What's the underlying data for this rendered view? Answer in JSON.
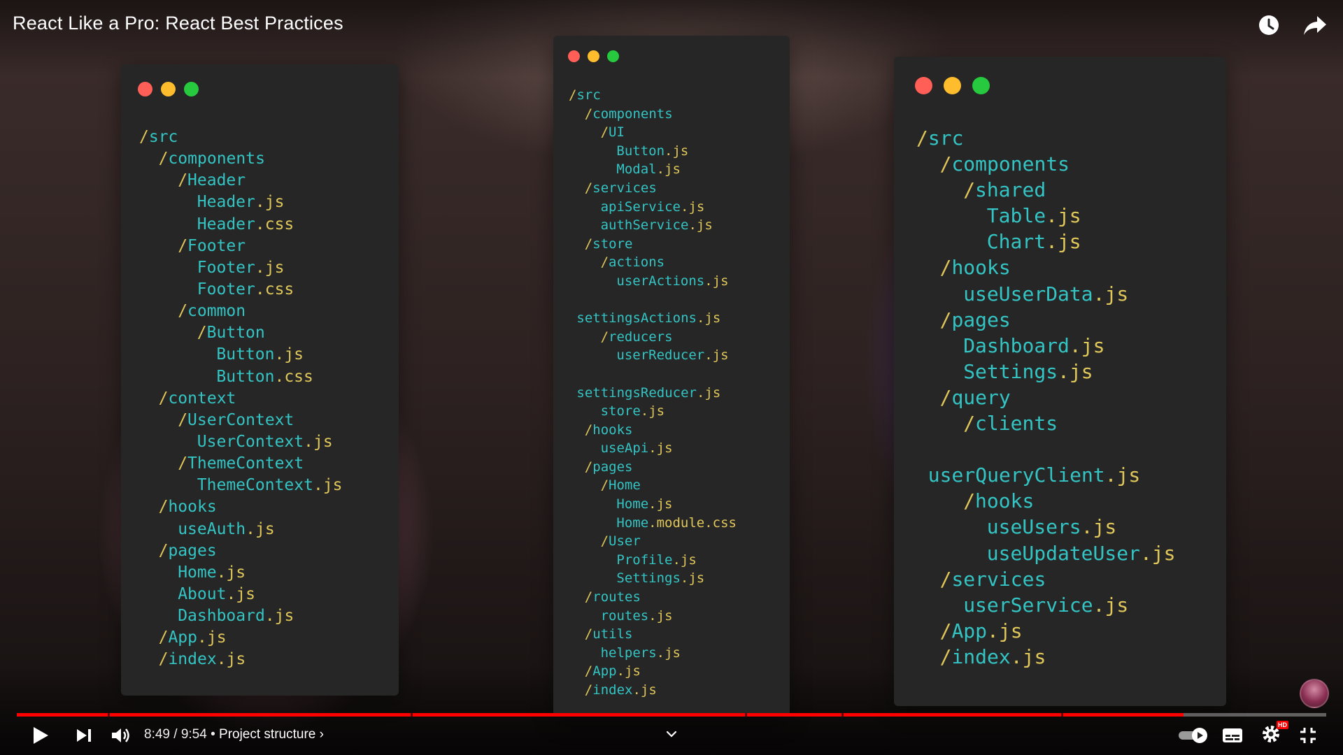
{
  "video": {
    "title": "React Like a Pro: React Best Practices",
    "current_time": "8:49",
    "duration": "9:54",
    "time_display": "8:49 / 9:54",
    "separator": " • ",
    "chapter": "Project structure",
    "chapter_chevron": "›",
    "progress": 0.891,
    "hd_badge": "HD"
  },
  "icons": {
    "watch_later": "clock-icon",
    "share": "share-arrow-icon",
    "play": "play-icon",
    "next": "skip-next-icon",
    "volume": "volume-icon",
    "expand": "chevron-down-icon",
    "autoplay": "autoplay-toggle-icon",
    "subtitles": "subtitles-icon",
    "settings": "gear-icon",
    "fullscreen_exit": "fullscreen-exit-icon"
  },
  "colors": {
    "progress_red": "#ff0000",
    "name_cyan": "#34c4c4",
    "punct_yellow": "#e0c75a",
    "panel_bg": "#262626"
  },
  "panels": [
    {
      "id": "left",
      "lines": [
        {
          "indent": 0,
          "prefix": "/",
          "name": "src",
          "ext": ""
        },
        {
          "indent": 1,
          "prefix": "/",
          "name": "components",
          "ext": ""
        },
        {
          "indent": 2,
          "prefix": "/",
          "name": "Header",
          "ext": ""
        },
        {
          "indent": 3,
          "prefix": "",
          "name": "Header",
          "ext": ".js"
        },
        {
          "indent": 3,
          "prefix": "",
          "name": "Header",
          "ext": ".css"
        },
        {
          "indent": 2,
          "prefix": "/",
          "name": "Footer",
          "ext": ""
        },
        {
          "indent": 3,
          "prefix": "",
          "name": "Footer",
          "ext": ".js"
        },
        {
          "indent": 3,
          "prefix": "",
          "name": "Footer",
          "ext": ".css"
        },
        {
          "indent": 2,
          "prefix": "/",
          "name": "common",
          "ext": ""
        },
        {
          "indent": 3,
          "prefix": "/",
          "name": "Button",
          "ext": ""
        },
        {
          "indent": 4,
          "prefix": "",
          "name": "Button",
          "ext": ".js"
        },
        {
          "indent": 4,
          "prefix": "",
          "name": "Button",
          "ext": ".css"
        },
        {
          "indent": 1,
          "prefix": "/",
          "name": "context",
          "ext": ""
        },
        {
          "indent": 2,
          "prefix": "/",
          "name": "UserContext",
          "ext": ""
        },
        {
          "indent": 3,
          "prefix": "",
          "name": "UserContext",
          "ext": ".js"
        },
        {
          "indent": 2,
          "prefix": "/",
          "name": "ThemeContext",
          "ext": ""
        },
        {
          "indent": 3,
          "prefix": "",
          "name": "ThemeContext",
          "ext": ".js"
        },
        {
          "indent": 1,
          "prefix": "/",
          "name": "hooks",
          "ext": ""
        },
        {
          "indent": 2,
          "prefix": "",
          "name": "useAuth",
          "ext": ".js"
        },
        {
          "indent": 1,
          "prefix": "/",
          "name": "pages",
          "ext": ""
        },
        {
          "indent": 2,
          "prefix": "",
          "name": "Home",
          "ext": ".js"
        },
        {
          "indent": 2,
          "prefix": "",
          "name": "About",
          "ext": ".js"
        },
        {
          "indent": 2,
          "prefix": "",
          "name": "Dashboard",
          "ext": ".js"
        },
        {
          "indent": 1,
          "prefix": "/",
          "name": "App",
          "ext": ".js"
        },
        {
          "indent": 1,
          "prefix": "/",
          "name": "index",
          "ext": ".js"
        }
      ]
    },
    {
      "id": "mid",
      "lines": [
        {
          "indent": 0,
          "prefix": "/",
          "name": "src",
          "ext": ""
        },
        {
          "indent": 1,
          "prefix": "/",
          "name": "components",
          "ext": ""
        },
        {
          "indent": 2,
          "prefix": "/",
          "name": "UI",
          "ext": ""
        },
        {
          "indent": 3,
          "prefix": "",
          "name": "Button",
          "ext": ".js"
        },
        {
          "indent": 3,
          "prefix": "",
          "name": "Modal",
          "ext": ".js"
        },
        {
          "indent": 1,
          "prefix": "/",
          "name": "services",
          "ext": ""
        },
        {
          "indent": 2,
          "prefix": "",
          "name": "apiService",
          "ext": ".js"
        },
        {
          "indent": 2,
          "prefix": "",
          "name": "authService",
          "ext": ".js"
        },
        {
          "indent": 1,
          "prefix": "/",
          "name": "store",
          "ext": ""
        },
        {
          "indent": 2,
          "prefix": "/",
          "name": "actions",
          "ext": ""
        },
        {
          "indent": 3,
          "prefix": "",
          "name": "userActions",
          "ext": ".js"
        },
        {
          "indent": 0,
          "prefix": "",
          "name": "",
          "ext": ""
        },
        {
          "indent": 0.5,
          "prefix": "",
          "name": "settingsActions",
          "ext": ".js"
        },
        {
          "indent": 2,
          "prefix": "/",
          "name": "reducers",
          "ext": ""
        },
        {
          "indent": 3,
          "prefix": "",
          "name": "userReducer",
          "ext": ".js"
        },
        {
          "indent": 0,
          "prefix": "",
          "name": "",
          "ext": ""
        },
        {
          "indent": 0.5,
          "prefix": "",
          "name": "settingsReducer",
          "ext": ".js"
        },
        {
          "indent": 2,
          "prefix": "",
          "name": "store",
          "ext": ".js"
        },
        {
          "indent": 1,
          "prefix": "/",
          "name": "hooks",
          "ext": ""
        },
        {
          "indent": 2,
          "prefix": "",
          "name": "useApi",
          "ext": ".js"
        },
        {
          "indent": 1,
          "prefix": "/",
          "name": "pages",
          "ext": ""
        },
        {
          "indent": 2,
          "prefix": "/",
          "name": "Home",
          "ext": ""
        },
        {
          "indent": 3,
          "prefix": "",
          "name": "Home",
          "ext": ".js"
        },
        {
          "indent": 3,
          "prefix": "",
          "name": "Home",
          "ext": ".module.css"
        },
        {
          "indent": 2,
          "prefix": "/",
          "name": "User",
          "ext": ""
        },
        {
          "indent": 3,
          "prefix": "",
          "name": "Profile",
          "ext": ".js"
        },
        {
          "indent": 3,
          "prefix": "",
          "name": "Settings",
          "ext": ".js"
        },
        {
          "indent": 1,
          "prefix": "/",
          "name": "routes",
          "ext": ""
        },
        {
          "indent": 2,
          "prefix": "",
          "name": "routes",
          "ext": ".js"
        },
        {
          "indent": 1,
          "prefix": "/",
          "name": "utils",
          "ext": ""
        },
        {
          "indent": 2,
          "prefix": "",
          "name": "helpers",
          "ext": ".js"
        },
        {
          "indent": 1,
          "prefix": "/",
          "name": "App",
          "ext": ".js"
        },
        {
          "indent": 1,
          "prefix": "/",
          "name": "index",
          "ext": ".js"
        }
      ]
    },
    {
      "id": "right",
      "lines": [
        {
          "indent": 0,
          "prefix": "/",
          "name": "src",
          "ext": ""
        },
        {
          "indent": 1,
          "prefix": "/",
          "name": "components",
          "ext": ""
        },
        {
          "indent": 2,
          "prefix": "/",
          "name": "shared",
          "ext": ""
        },
        {
          "indent": 3,
          "prefix": "",
          "name": "Table",
          "ext": ".js"
        },
        {
          "indent": 3,
          "prefix": "",
          "name": "Chart",
          "ext": ".js"
        },
        {
          "indent": 1,
          "prefix": "/",
          "name": "hooks",
          "ext": ""
        },
        {
          "indent": 2,
          "prefix": "",
          "name": "useUserData",
          "ext": ".js"
        },
        {
          "indent": 1,
          "prefix": "/",
          "name": "pages",
          "ext": ""
        },
        {
          "indent": 2,
          "prefix": "",
          "name": "Dashboard",
          "ext": ".js"
        },
        {
          "indent": 2,
          "prefix": "",
          "name": "Settings",
          "ext": ".js"
        },
        {
          "indent": 1,
          "prefix": "/",
          "name": "query",
          "ext": ""
        },
        {
          "indent": 2,
          "prefix": "/",
          "name": "clients",
          "ext": ""
        },
        {
          "indent": 0,
          "prefix": "",
          "name": "",
          "ext": ""
        },
        {
          "indent": 0.5,
          "prefix": "",
          "name": "userQueryClient",
          "ext": ".js"
        },
        {
          "indent": 2,
          "prefix": "/",
          "name": "hooks",
          "ext": ""
        },
        {
          "indent": 3,
          "prefix": "",
          "name": "useUsers",
          "ext": ".js"
        },
        {
          "indent": 3,
          "prefix": "",
          "name": "useUpdateUser",
          "ext": ".js"
        },
        {
          "indent": 1,
          "prefix": "/",
          "name": "services",
          "ext": ""
        },
        {
          "indent": 2,
          "prefix": "",
          "name": "userService",
          "ext": ".js"
        },
        {
          "indent": 1,
          "prefix": "/",
          "name": "App",
          "ext": ".js"
        },
        {
          "indent": 1,
          "prefix": "/",
          "name": "index",
          "ext": ".js"
        }
      ]
    }
  ]
}
